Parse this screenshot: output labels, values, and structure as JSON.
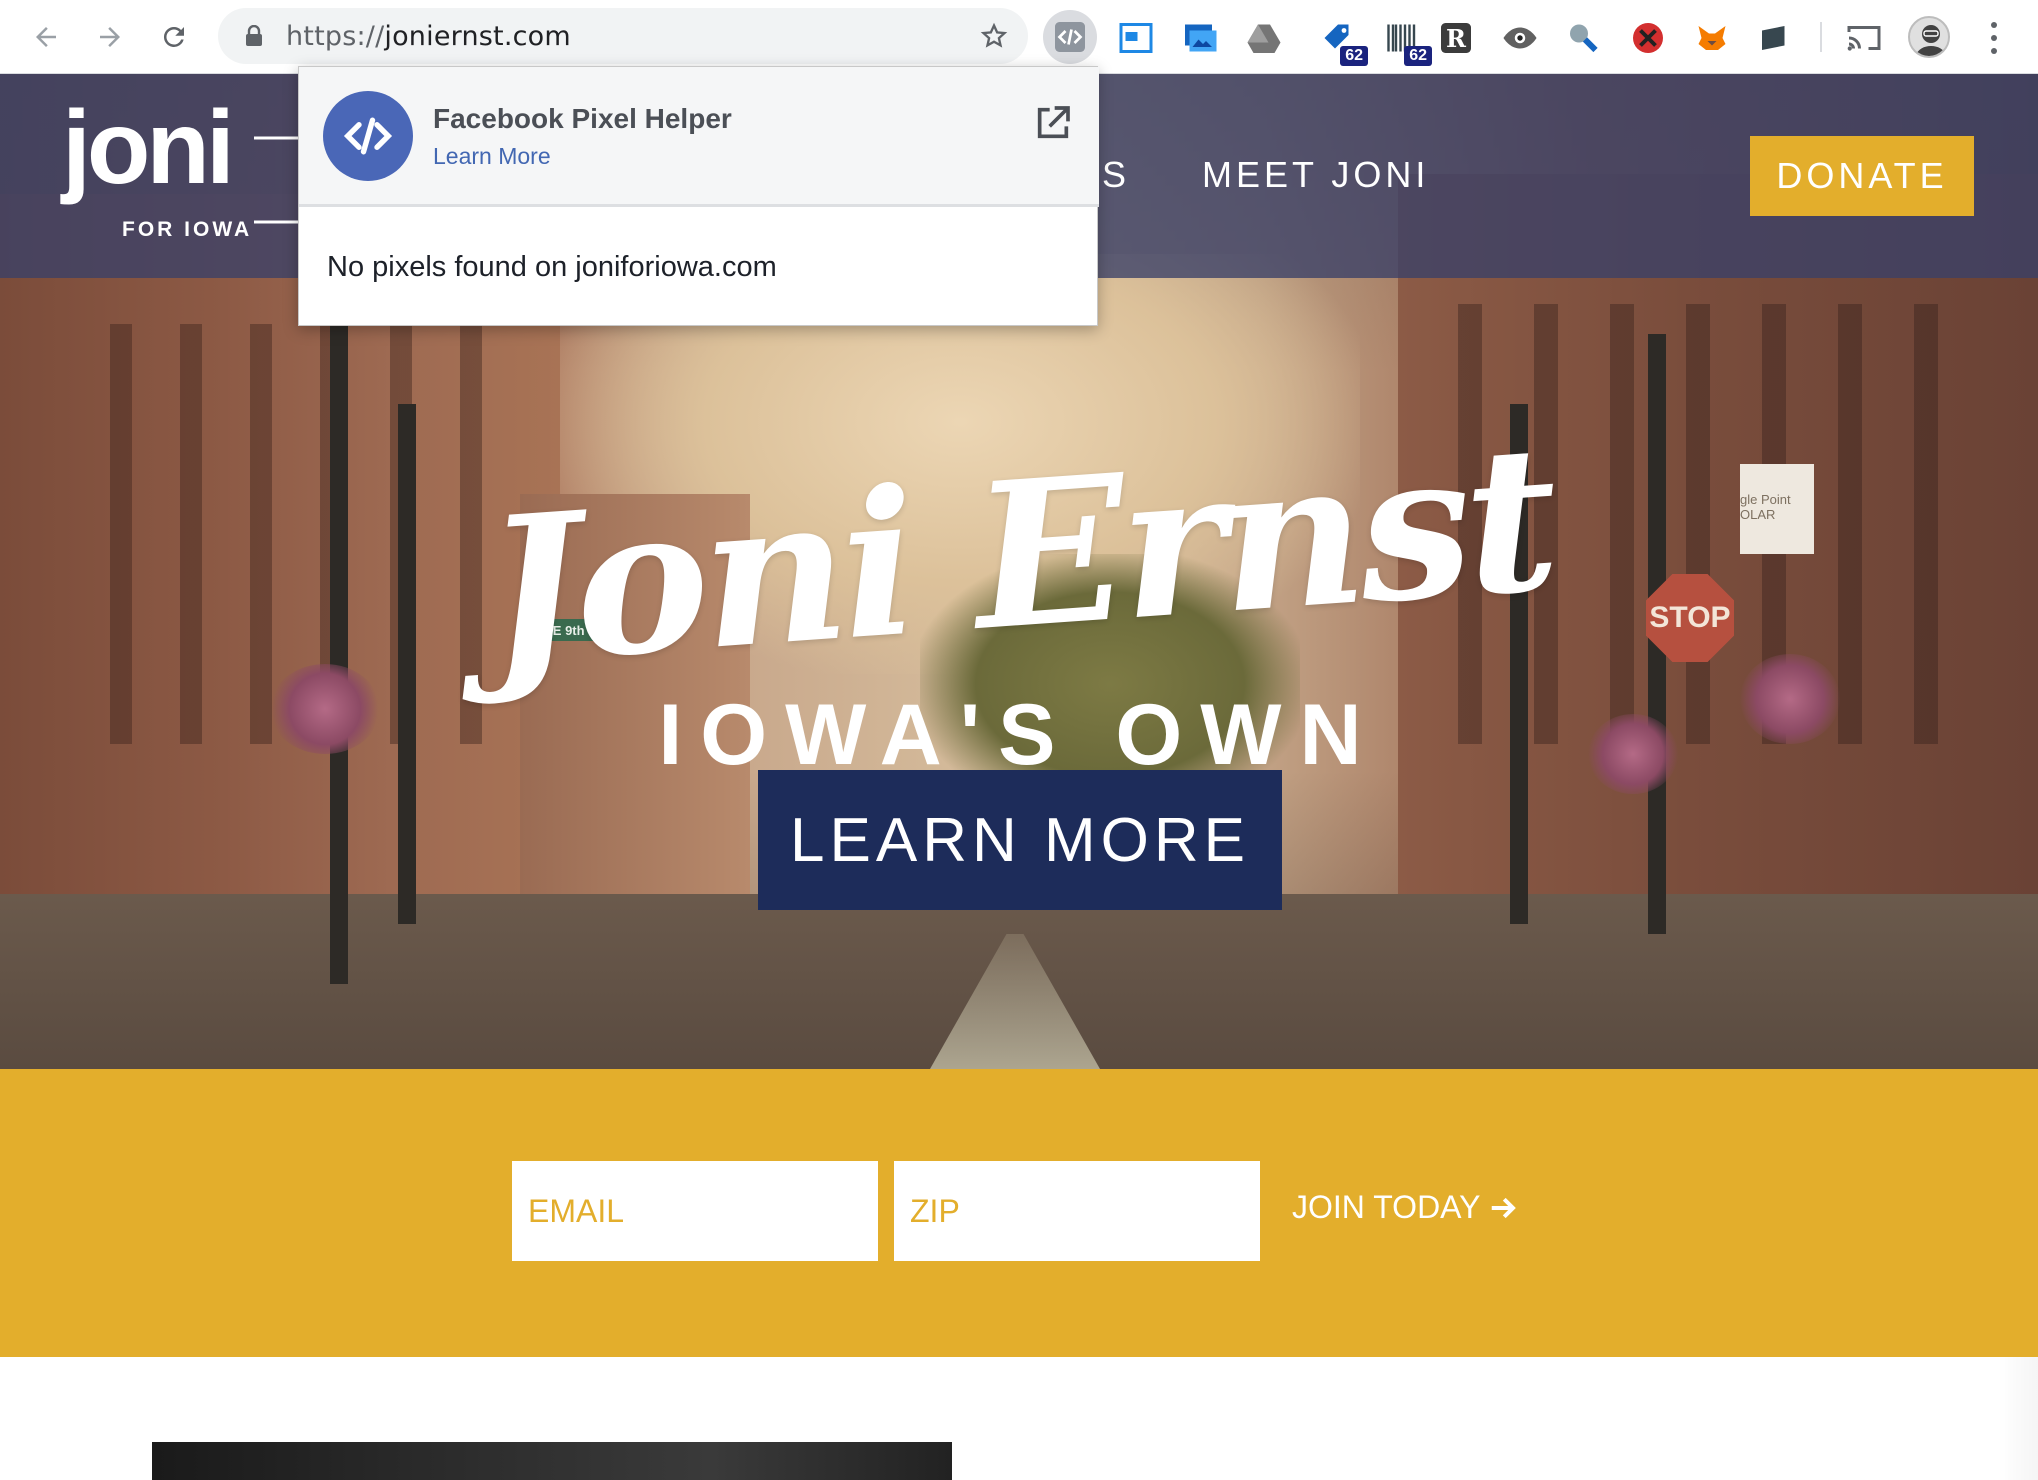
{
  "browser": {
    "url_scheme": "https://",
    "url_host": "joniernst.com",
    "extensions": [
      {
        "name": "facebook-pixel-helper"
      },
      {
        "name": "window-capture"
      },
      {
        "name": "screenshot"
      },
      {
        "name": "drive"
      },
      {
        "name": "extension-a",
        "badge": "62"
      },
      {
        "name": "extension-b",
        "badge": "62"
      },
      {
        "name": "readability"
      },
      {
        "name": "eye"
      },
      {
        "name": "search-tool"
      },
      {
        "name": "blocker"
      },
      {
        "name": "metamask"
      },
      {
        "name": "extension-c"
      },
      {
        "name": "cast"
      }
    ]
  },
  "popup": {
    "title": "Facebook Pixel Helper",
    "link": "Learn More",
    "message": "No pixels found on joniforiowa.com"
  },
  "site": {
    "logo_word": "joni",
    "logo_sub": "FOR IOWA",
    "nav": [
      {
        "label": "S"
      },
      {
        "label": "MEET JONI"
      }
    ],
    "donate": "DONATE"
  },
  "hero": {
    "script_title": "Joni Ernst",
    "tagline": "IOWA'S OWN",
    "cta": "LEARN MORE",
    "street_sign": "E 9th St",
    "stop_sign": "STOP",
    "shop_sign": "gle Point OLAR"
  },
  "signup": {
    "email_placeholder": "EMAIL",
    "zip_placeholder": "ZIP",
    "join": "JOIN TODAY"
  },
  "colors": {
    "gold": "#e3ae2c",
    "navy": "#1d2c5a",
    "header_overlay": "#3a4068",
    "fb_blue": "#4a67b7"
  }
}
